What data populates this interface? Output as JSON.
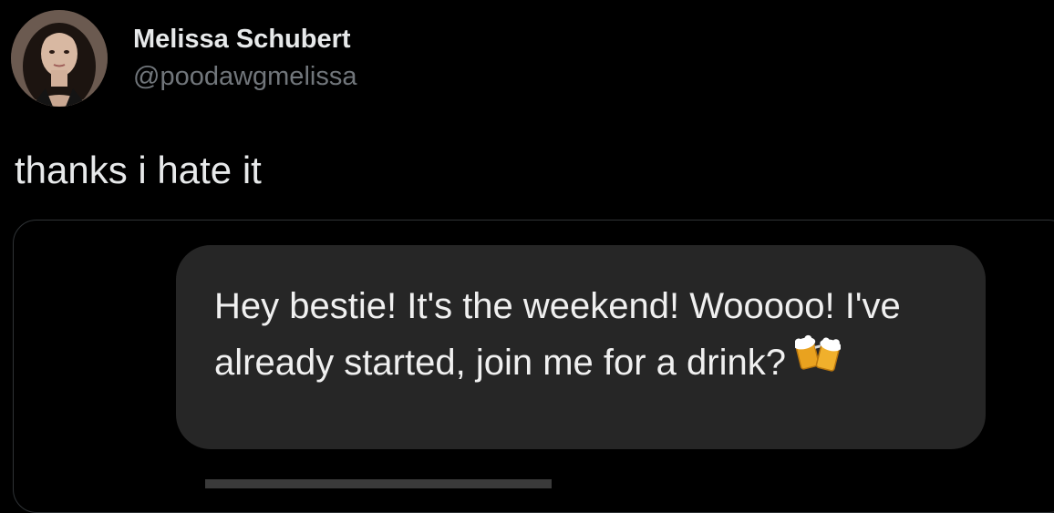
{
  "tweet": {
    "author": {
      "display_name": "Melissa Schubert",
      "handle": "@poodawgmelissa",
      "avatar_icon": "profile-photo"
    },
    "text": "thanks i hate it",
    "media": {
      "message": "Hey bestie! It's the weekend! Wooooo! I've already started, join me for a drink?",
      "emoji_icon": "beer-mugs-icon"
    }
  },
  "colors": {
    "background": "#000000",
    "primary_text": "#e7e9ea",
    "secondary_text": "#71767b",
    "bubble": "#262626",
    "card_border": "#2f3336"
  }
}
